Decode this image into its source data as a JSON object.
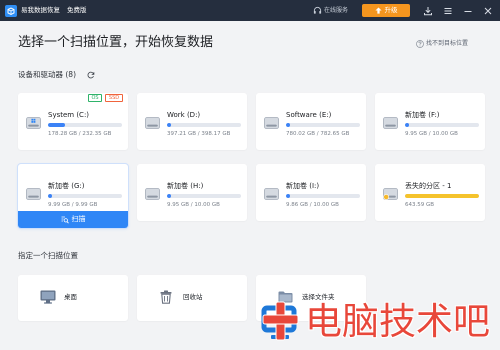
{
  "titlebar": {
    "app_name": "易我数据恢复",
    "edition": "免费版",
    "online_service": "在线服务",
    "upgrade_label": "升级"
  },
  "header": {
    "title": "选择一个扫描位置，开始恢复数据",
    "help_link": "找不到目标位置"
  },
  "devices": {
    "heading": "设备和驱动器 (8)",
    "scan_label": "扫描",
    "drives": [
      {
        "name": "System (C:)",
        "size": "178.28 GB / 232.35 GB",
        "usage_fill": 0.23,
        "tags": [
          "OS",
          "SSD"
        ],
        "icon": "windows-drive-icon"
      },
      {
        "name": "Work (D:)",
        "size": "397.21 GB / 398.17 GB",
        "usage_fill": 0.05,
        "icon": "drive-icon"
      },
      {
        "name": "Software (E:)",
        "size": "780.02 GB / 782.65 GB",
        "usage_fill": 0.05,
        "icon": "drive-icon"
      },
      {
        "name": "新加卷 (F:)",
        "size": "9.95 GB / 10.00 GB",
        "usage_fill": 0.05,
        "icon": "drive-icon"
      },
      {
        "name": "新加卷 (G:)",
        "size": "9.99 GB / 9.99 GB",
        "usage_fill": 0.05,
        "icon": "drive-icon",
        "selected": true
      },
      {
        "name": "新加卷 (H:)",
        "size": "9.95 GB / 10.00 GB",
        "usage_fill": 0.05,
        "icon": "drive-icon"
      },
      {
        "name": "新加卷 (I:)",
        "size": "9.86 GB / 10.00 GB",
        "usage_fill": 0.05,
        "icon": "drive-icon"
      },
      {
        "name": "丢失的分区 - 1",
        "size": "643.59 GB",
        "usage_fill": 1.0,
        "icon": "lost-partition-icon",
        "lost": true
      }
    ]
  },
  "locations": {
    "heading": "指定一个扫描位置",
    "items": [
      {
        "label": "桌面",
        "icon": "monitor-icon"
      },
      {
        "label": "回收站",
        "icon": "recycle-bin-icon"
      },
      {
        "label": "选择文件夹",
        "icon": "folder-icon"
      }
    ]
  },
  "watermark": {
    "text": "电脑技术吧"
  },
  "colors": {
    "titlebar": "#252e3e",
    "background": "#f2f3f5",
    "accent": "#2f86f6",
    "upgrade": "#f5961f",
    "usage_fill": "#3b82f6",
    "usage_track": "#e3e7ee",
    "lost_partition": "#f5c32c",
    "tag_os": "#2fb36a",
    "tag_ssd": "#f0643c",
    "watermark": "#e8473a"
  }
}
